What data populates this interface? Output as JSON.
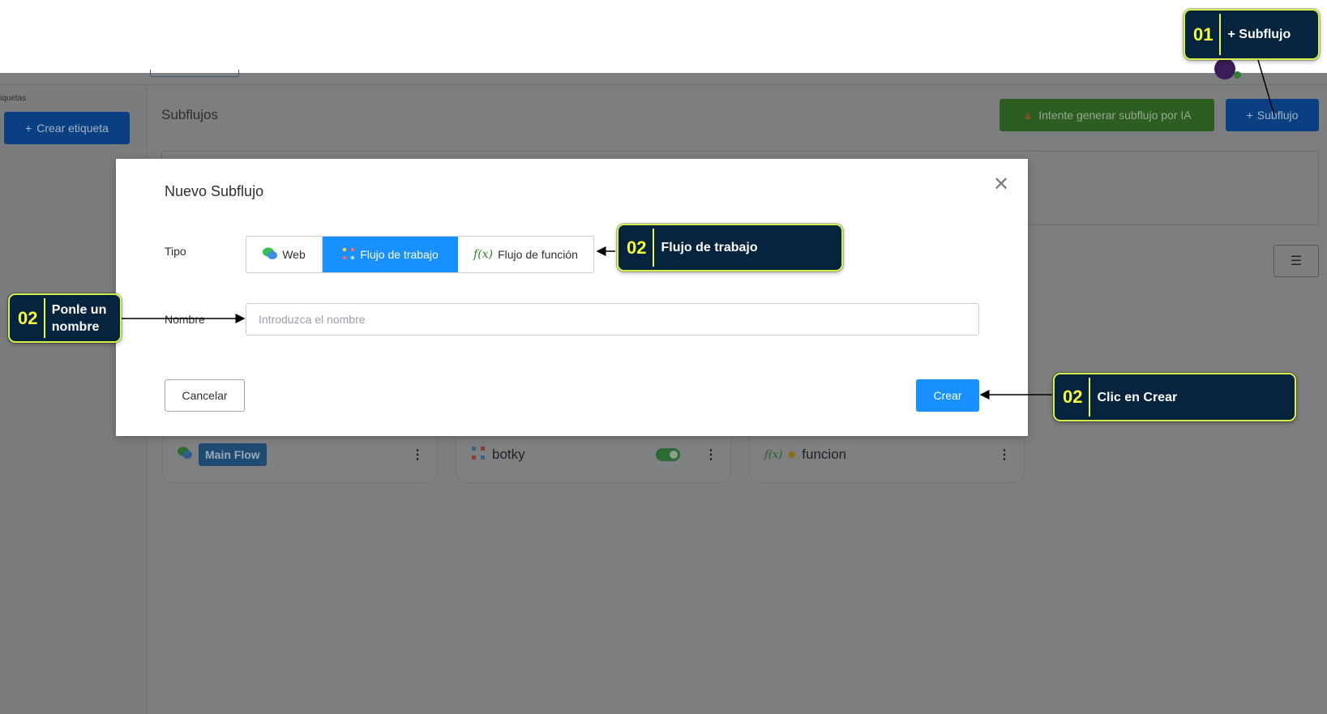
{
  "background_app": {
    "left_label": "iquetas",
    "create_tag_label": "Crear etiqueta",
    "page_title": "Subflujos",
    "ai_button_label": "Intente generar subflujo por IA",
    "add_subflow_label": "Subflujo",
    "cards": [
      {
        "title": "Main Flow"
      },
      {
        "title": "botky"
      },
      {
        "title": "funcion"
      }
    ]
  },
  "modal": {
    "title": "Nuevo Subflujo",
    "type_label": "Tipo",
    "types": [
      {
        "label": "Web",
        "selected": false
      },
      {
        "label": "Flujo de trabajo",
        "selected": true
      },
      {
        "label": "Flujo de función",
        "selected": false
      }
    ],
    "name_label": "Nombre",
    "name_placeholder": "Introduzca el nombre",
    "name_value": "",
    "cancel_label": "Cancelar",
    "create_label": "Crear"
  },
  "callouts": [
    {
      "num": "01",
      "text": "+ Subflujo"
    },
    {
      "num": "02",
      "text": "Flujo de trabajo"
    },
    {
      "num": "02",
      "text": "Ponle un nombre"
    },
    {
      "num": "02",
      "text": "Clic en Crear"
    }
  ],
  "colors": {
    "accent": "#1890ff",
    "callout_bg": "#06243e",
    "callout_border": "#d6f24a",
    "callout_num": "#f4ff3a",
    "overlay": "#7d7e80"
  }
}
